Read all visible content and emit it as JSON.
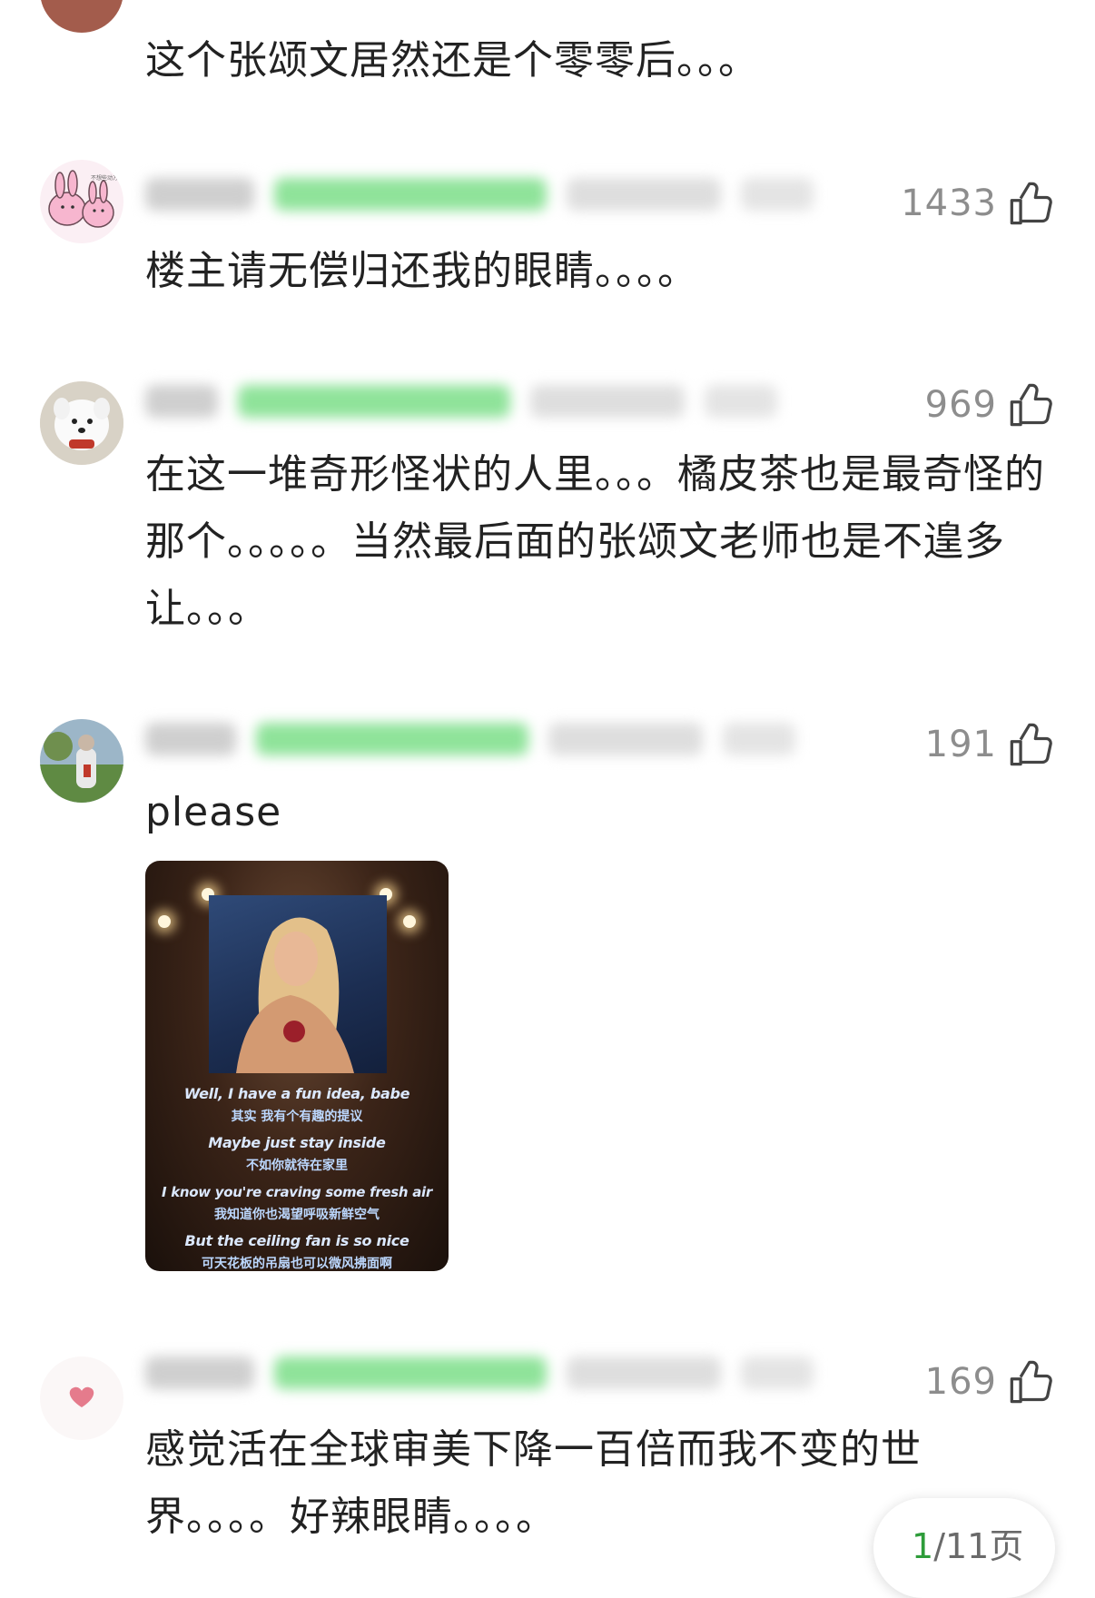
{
  "comments": [
    {
      "text": "这个张颂文居然还是个零零后。。。"
    },
    {
      "likes": "1433",
      "text": "楼主请无偿归还我的眼睛。。。。",
      "avatar_text": "不想些动方"
    },
    {
      "likes": "969",
      "text": "在这一堆奇形怪状的人里。。。橘皮茶也是最奇怪的那个。。。。。当然最后面的张颂文老师也是不遑多让。。。"
    },
    {
      "likes": "191",
      "text": "please",
      "image": {
        "lyrics": [
          "Well, I have a fun idea, babe",
          "其实 我有个有趣的提议",
          "Maybe just stay inside",
          "不如你就待在家里",
          "I know you're craving some fresh air",
          "我知道你也渴望呼吸新鲜空气",
          "But the ceiling fan is so nice",
          "可天花板的吊扇也可以微风拂面啊"
        ]
      }
    },
    {
      "likes": "169",
      "text": "感觉活在全球审美下降一百倍而我不变的世界。。。。好辣眼睛。。。。"
    }
  ],
  "pager": {
    "current": "1",
    "total": "/11页"
  },
  "colors": {
    "like_count": "#8d8d8d",
    "tag_blur": "#8fe39a",
    "pager_current": "#2e9c3a"
  },
  "icons": {
    "like": "thumbs-up-icon"
  }
}
